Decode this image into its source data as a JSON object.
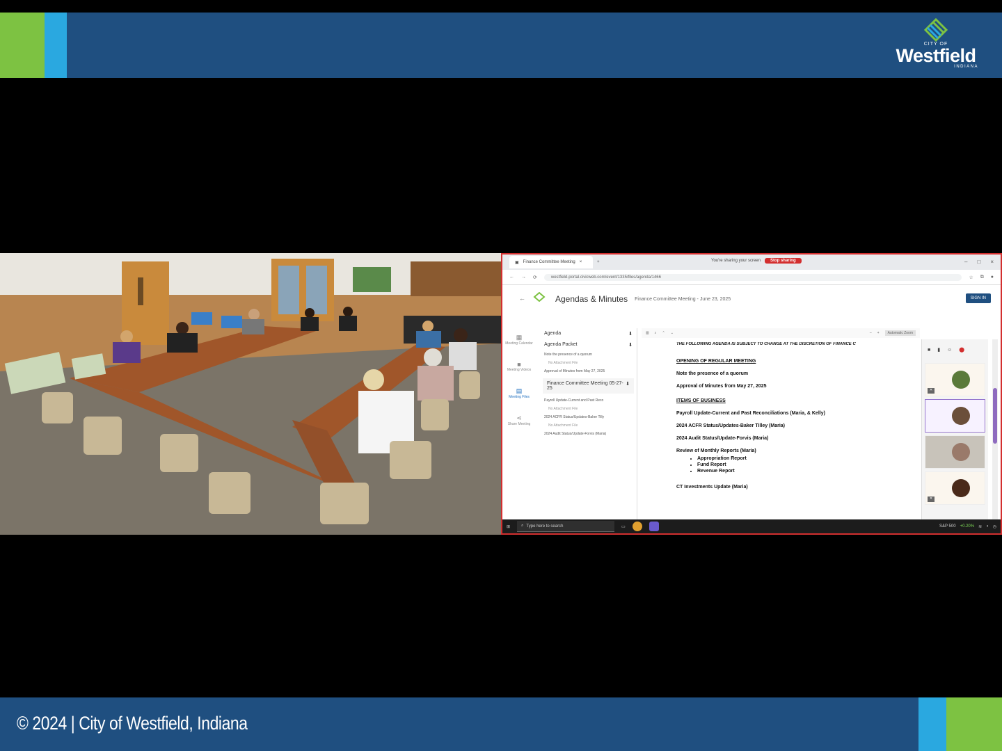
{
  "banner": {
    "logo": {
      "city_of": "CITY OF",
      "name": "Westfield",
      "state": "INDIANA"
    },
    "copyright": "© 2024 | City of Westfield, Indiana",
    "colors": {
      "navy": "#1f4f80",
      "green": "#7dc242",
      "cyan": "#2aa8e0"
    }
  },
  "camera": {
    "description_icon": "conference-room-video"
  },
  "screen_share": {
    "browser": {
      "tab_label": "Finance Committee Meeting",
      "share_notice": "You're sharing your screen",
      "stop_sharing": "Stop sharing",
      "url": "westfield-portal.civicweb.com/event/1335/files/agenda/1466"
    },
    "app": {
      "title": "Agendas & Minutes",
      "meeting": "Finance Committee Meeting - June 23, 2025",
      "sign_in": "SIGN IN"
    },
    "rail": [
      {
        "label": "Meeting Calendar",
        "icon": "calendar-icon"
      },
      {
        "label": "Meeting Videos",
        "icon": "video-icon"
      },
      {
        "label": "Meeting Files",
        "icon": "files-icon"
      },
      {
        "label": "Share Meeting",
        "icon": "share-icon"
      }
    ],
    "files": {
      "agenda": "Agenda",
      "agenda_packet": "Agenda Packet",
      "item1": "Note the presence of a quorum",
      "no_attachment": "No Attachment File",
      "item2": "Approval of Minutes from May 27, 2025",
      "card": "Finance Committee Meeting 05-27-25",
      "item3": "Payroll Update-Current and Past Reco",
      "item4": "2024 ACFR Status/Updates-Baker Tilly",
      "item5": "2024 Audit Status/Update-Forvis (Maria)"
    },
    "pdf": {
      "zoom": "Automatic Zoom",
      "notice": "THE FOLLOWING AGENDA IS SUBJECT TO CHANGE AT THE DISCRETION OF FINANCE C",
      "opening": "OPENING OF REGULAR MEETING",
      "quorum": "Note the presence of a quorum",
      "minutes": "Approval of Minutes from May 27, 2025",
      "items": "ITEMS OF BUSINESS",
      "payroll": "Payroll Update-Current and Past Reconciliations (Maria, & Kelly)",
      "acfr": "2024 ACFR Status/Updates-Baker Tilley (Maria)",
      "audit": "2024 Audit Status/Update-Forvis (Maria)",
      "monthly": "Review of Monthly Reports (Maria)",
      "reports": [
        "Appropriation Report",
        "Fund Report",
        "Revenue Report"
      ],
      "ct": "CT Investments Update (Maria)"
    },
    "taskbar": {
      "search": "Type here to search",
      "stock": "S&P 500",
      "stock_change": "+0.20%"
    }
  }
}
